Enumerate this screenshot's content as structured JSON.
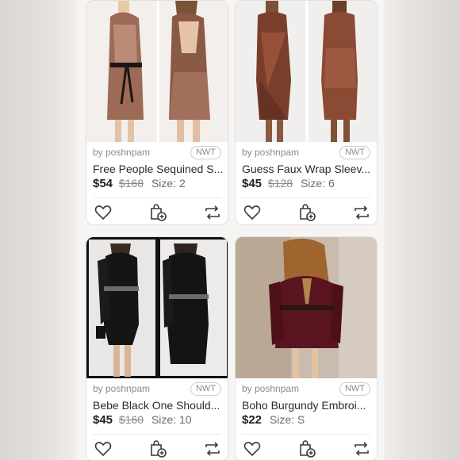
{
  "listings": [
    {
      "seller": "by poshnpam",
      "badge": "NWT",
      "title": "Free People Sequined S...",
      "price": "$54",
      "original_price": "$168",
      "size": "Size: 2"
    },
    {
      "seller": "by poshnpam",
      "badge": "NWT",
      "title": "Guess Faux Wrap Sleev...",
      "price": "$45",
      "original_price": "$128",
      "size": "Size: 6"
    },
    {
      "seller": "by poshnpam",
      "badge": "NWT",
      "title": "Bebe Black One Should...",
      "price": "$45",
      "original_price": "$160",
      "size": "Size: 10"
    },
    {
      "seller": "by poshnpam",
      "badge": "NWT",
      "title": "Boho Burgundy Embroi...",
      "price": "$22",
      "original_price": "",
      "size": "Size: S"
    }
  ],
  "icons": {
    "like": "heart-icon",
    "bundle": "shopping-bag-add-icon",
    "share": "share-repost-icon"
  },
  "colors": {
    "page_background": "#f6f5f4",
    "card_border": "#e2e0de",
    "text_primary": "#2b2b2b",
    "text_muted": "#8e8a87"
  }
}
